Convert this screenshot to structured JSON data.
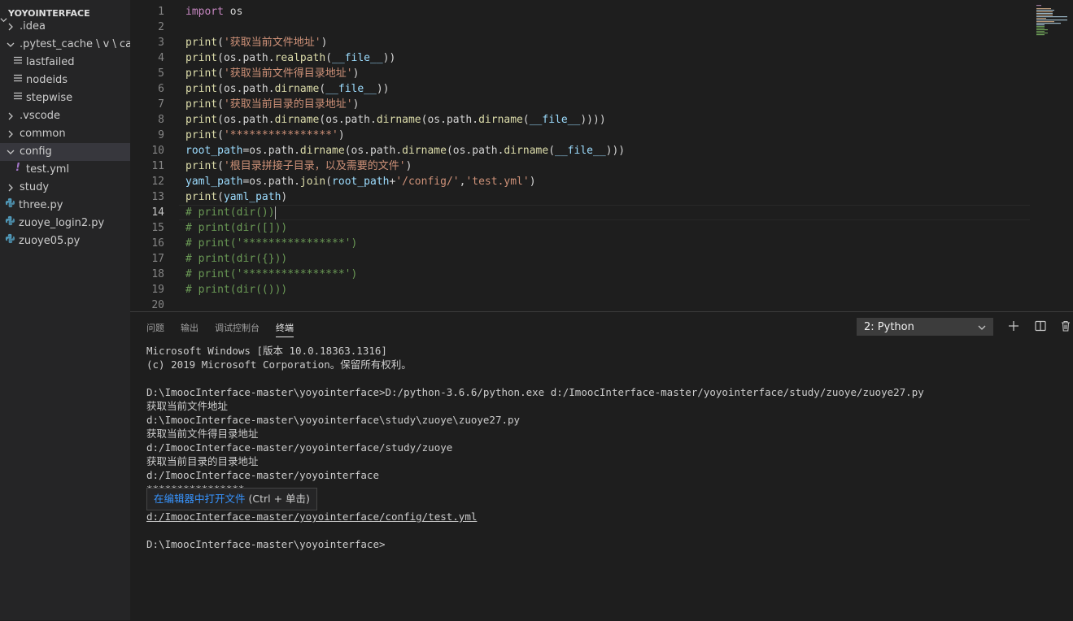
{
  "explorer": {
    "root_label": "YOYOINTERFACE",
    "items": [
      {
        "label": ".idea",
        "type": "folder",
        "expanded": false,
        "indent": 0
      },
      {
        "label": ".pytest_cache \\ v \\ cache",
        "type": "folder",
        "expanded": true,
        "indent": 0
      },
      {
        "label": "lastfailed",
        "type": "file",
        "icon": "lines-icon",
        "indent": 1
      },
      {
        "label": "nodeids",
        "type": "file",
        "icon": "lines-icon",
        "indent": 1
      },
      {
        "label": "stepwise",
        "type": "file",
        "icon": "lines-icon",
        "indent": 1
      },
      {
        "label": ".vscode",
        "type": "folder",
        "expanded": false,
        "indent": 0
      },
      {
        "label": "common",
        "type": "folder",
        "expanded": false,
        "indent": 0
      },
      {
        "label": "config",
        "type": "folder",
        "expanded": true,
        "indent": 0,
        "selected": true
      },
      {
        "label": "test.yml",
        "type": "file",
        "icon": "yaml-icon",
        "indent": 1
      },
      {
        "label": "study",
        "type": "folder",
        "expanded": false,
        "indent": 0
      },
      {
        "label": "three.py",
        "type": "file",
        "icon": "python-icon",
        "indent": 0
      },
      {
        "label": "zuoye_login2.py",
        "type": "file",
        "icon": "python-icon",
        "indent": 0
      },
      {
        "label": "zuoye05.py",
        "type": "file",
        "icon": "python-icon",
        "indent": 0
      }
    ]
  },
  "editor": {
    "active_line": 14,
    "lines": [
      {
        "n": "1",
        "tokens": [
          [
            "kw",
            "import"
          ],
          [
            "txt",
            " os"
          ]
        ]
      },
      {
        "n": "2",
        "tokens": []
      },
      {
        "n": "3",
        "tokens": [
          [
            "fn",
            "print"
          ],
          [
            "txt",
            "("
          ],
          [
            "str",
            "'获取当前文件地址'"
          ],
          [
            "txt",
            ")"
          ]
        ]
      },
      {
        "n": "4",
        "tokens": [
          [
            "fn",
            "print"
          ],
          [
            "txt",
            "(os.path."
          ],
          [
            "fn",
            "realpath"
          ],
          [
            "txt",
            "("
          ],
          [
            "var",
            "__file__"
          ],
          [
            "txt",
            "))"
          ]
        ]
      },
      {
        "n": "5",
        "tokens": [
          [
            "fn",
            "print"
          ],
          [
            "txt",
            "("
          ],
          [
            "str",
            "'获取当前文件得目录地址'"
          ],
          [
            "txt",
            ")"
          ]
        ]
      },
      {
        "n": "6",
        "tokens": [
          [
            "fn",
            "print"
          ],
          [
            "txt",
            "(os.path."
          ],
          [
            "fn",
            "dirname"
          ],
          [
            "txt",
            "("
          ],
          [
            "var",
            "__file__"
          ],
          [
            "txt",
            "))"
          ]
        ]
      },
      {
        "n": "7",
        "tokens": [
          [
            "fn",
            "print"
          ],
          [
            "txt",
            "("
          ],
          [
            "str",
            "'获取当前目录的目录地址'"
          ],
          [
            "txt",
            ")"
          ]
        ]
      },
      {
        "n": "8",
        "tokens": [
          [
            "fn",
            "print"
          ],
          [
            "txt",
            "(os.path."
          ],
          [
            "fn",
            "dirname"
          ],
          [
            "txt",
            "(os.path."
          ],
          [
            "fn",
            "dirname"
          ],
          [
            "txt",
            "(os.path."
          ],
          [
            "fn",
            "dirname"
          ],
          [
            "txt",
            "("
          ],
          [
            "var",
            "__file__"
          ],
          [
            "txt",
            "))))"
          ]
        ]
      },
      {
        "n": "9",
        "tokens": [
          [
            "fn",
            "print"
          ],
          [
            "txt",
            "("
          ],
          [
            "str",
            "'****************'"
          ],
          [
            "txt",
            ")"
          ]
        ]
      },
      {
        "n": "10",
        "tokens": [
          [
            "var",
            "root_path"
          ],
          [
            "txt",
            "=os.path."
          ],
          [
            "fn",
            "dirname"
          ],
          [
            "txt",
            "(os.path."
          ],
          [
            "fn",
            "dirname"
          ],
          [
            "txt",
            "(os.path."
          ],
          [
            "fn",
            "dirname"
          ],
          [
            "txt",
            "("
          ],
          [
            "var",
            "__file__"
          ],
          [
            "txt",
            ")))"
          ]
        ]
      },
      {
        "n": "11",
        "tokens": [
          [
            "fn",
            "print"
          ],
          [
            "txt",
            "("
          ],
          [
            "str",
            "'根目录拼接子目录，以及需要的文件'"
          ],
          [
            "txt",
            ")"
          ]
        ]
      },
      {
        "n": "12",
        "tokens": [
          [
            "var",
            "yaml_path"
          ],
          [
            "txt",
            "=os.path."
          ],
          [
            "fn",
            "join"
          ],
          [
            "txt",
            "("
          ],
          [
            "var",
            "root_path"
          ],
          [
            "txt",
            "+"
          ],
          [
            "str",
            "'/config/'"
          ],
          [
            "txt",
            ","
          ],
          [
            "str",
            "'test.yml'"
          ],
          [
            "txt",
            ")"
          ]
        ]
      },
      {
        "n": "13",
        "tokens": [
          [
            "fn",
            "print"
          ],
          [
            "txt",
            "("
          ],
          [
            "var",
            "yaml_path"
          ],
          [
            "txt",
            ")"
          ]
        ]
      },
      {
        "n": "14",
        "tokens": [
          [
            "cm",
            "# print(dir())"
          ]
        ],
        "cursor": true
      },
      {
        "n": "15",
        "tokens": [
          [
            "cm",
            "# print(dir([]))"
          ]
        ]
      },
      {
        "n": "16",
        "tokens": [
          [
            "cm",
            "# print('****************')"
          ]
        ]
      },
      {
        "n": "17",
        "tokens": [
          [
            "cm",
            "# print(dir({}))"
          ]
        ]
      },
      {
        "n": "18",
        "tokens": [
          [
            "cm",
            "# print('****************')"
          ]
        ]
      },
      {
        "n": "19",
        "tokens": [
          [
            "cm",
            "# print(dir(()))"
          ]
        ]
      },
      {
        "n": "20",
        "tokens": []
      }
    ]
  },
  "panel": {
    "tabs": [
      {
        "label": "问题",
        "active": false
      },
      {
        "label": "输出",
        "active": false
      },
      {
        "label": "调试控制台",
        "active": false
      },
      {
        "label": "终端",
        "active": true
      }
    ],
    "terminal_select": "2: Python",
    "terminal_lines": [
      {
        "text": "Microsoft Windows [版本 10.0.18363.1316]"
      },
      {
        "text": "(c) 2019 Microsoft Corporation。保留所有权利。"
      },
      {
        "text": ""
      },
      {
        "text": "D:\\ImoocInterface-master\\yoyointerface>D:/python-3.6.6/python.exe d:/ImoocInterface-master/yoyointerface/study/zuoye/zuoye27.py"
      },
      {
        "text": "获取当前文件地址"
      },
      {
        "text": "d:\\ImoocInterface-master\\yoyointerface\\study\\zuoye\\zuoye27.py"
      },
      {
        "text": "获取当前文件得目录地址"
      },
      {
        "text": "d:/ImoocInterface-master/yoyointerface/study/zuoye"
      },
      {
        "text": "获取当前目录的目录地址"
      },
      {
        "text": "d:/ImoocInterface-master/yoyointerface"
      },
      {
        "text": "****************"
      },
      {
        "text": "根目录拼接子目录，以及需要的文件"
      },
      {
        "text": "d:/ImoocInterface-master/yoyointerface/config/test.yml",
        "link": true
      },
      {
        "text": ""
      },
      {
        "text": "D:\\ImoocInterface-master\\yoyointerface>"
      }
    ],
    "tooltip": {
      "link_text": "在编辑器中打开文件",
      "hint_text": " (Ctrl + 单击)"
    }
  },
  "colors": {
    "keyword": "#c586c0",
    "function": "#dcdcaa",
    "string": "#ce9178",
    "variable": "#9cdcfe",
    "comment": "#6a9955",
    "python_icon": "#519aba",
    "yaml_icon": "#a074c4"
  }
}
